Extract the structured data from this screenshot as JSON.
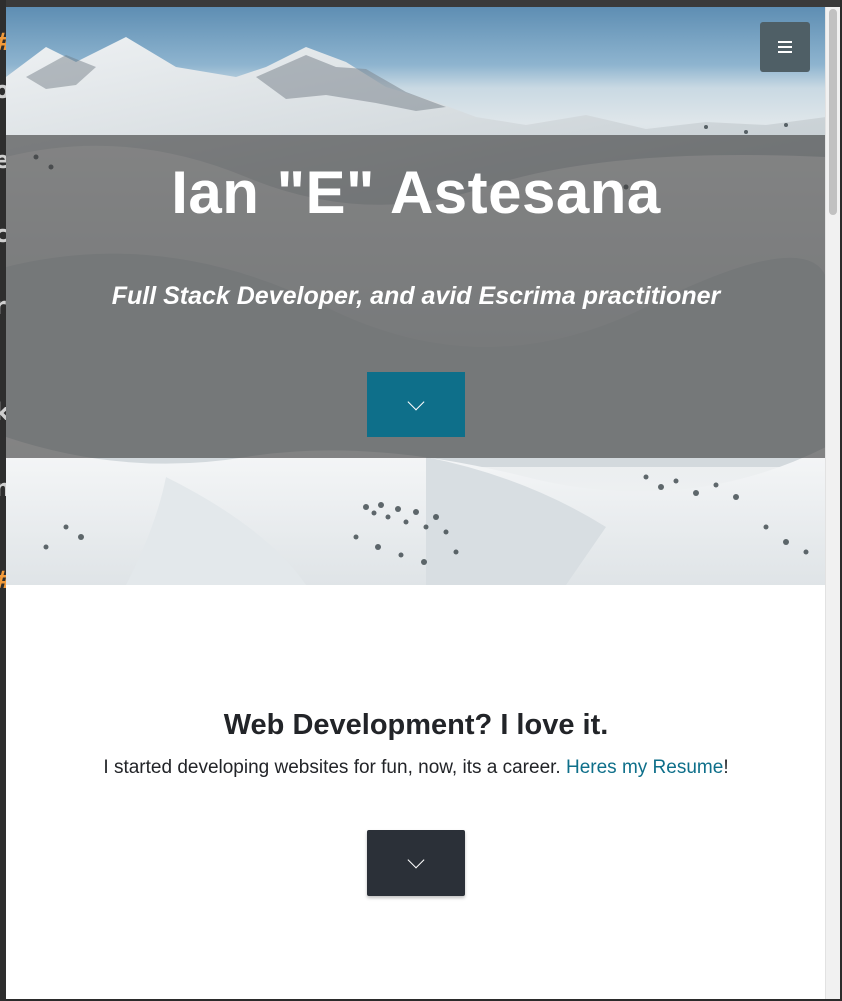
{
  "header": {
    "menu_icon": "hamburger-menu-icon"
  },
  "hero": {
    "title": "Ian \"E\" Astesana",
    "subtitle": "Full Stack Developer, and avid Escrima practitioner",
    "down_icon": "chevron-down-icon",
    "accent_color": "#0e6f8a"
  },
  "about": {
    "title": "Web Development? I love it.",
    "text_before_link": "I started developing websites for fun, now, its a career. ",
    "link_label": "Heres my Resume",
    "text_after_link": "!",
    "down_icon": "chevron-down-icon",
    "button_color": "#2b3038"
  }
}
